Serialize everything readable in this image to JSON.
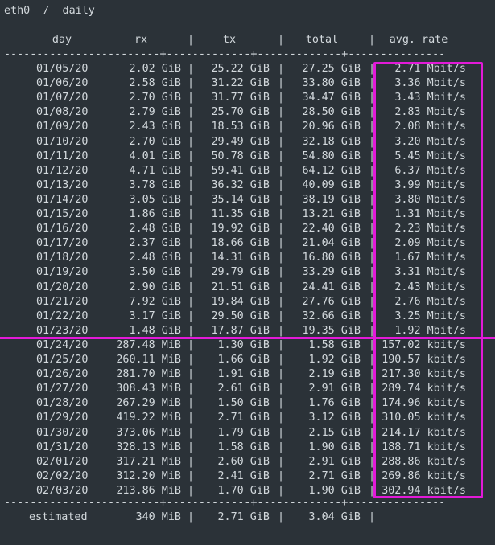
{
  "title": "eth0  /  daily",
  "header": {
    "day": "day",
    "rx": "rx",
    "tx": "tx",
    "total": "total",
    "rate": "avg. rate"
  },
  "separator_top": "------------------------+-------------+-------------+---------------",
  "separator_bottom": "------------------------+-------------+-------------+---------------",
  "rows": [
    {
      "day": "01/05/20",
      "rx": "2.02 GiB",
      "tx": "25.22 GiB",
      "total": "27.25 GiB",
      "rate": "2.71 Mbit/s"
    },
    {
      "day": "01/06/20",
      "rx": "2.58 GiB",
      "tx": "31.22 GiB",
      "total": "33.80 GiB",
      "rate": "3.36 Mbit/s"
    },
    {
      "day": "01/07/20",
      "rx": "2.70 GiB",
      "tx": "31.77 GiB",
      "total": "34.47 GiB",
      "rate": "3.43 Mbit/s"
    },
    {
      "day": "01/08/20",
      "rx": "2.79 GiB",
      "tx": "25.70 GiB",
      "total": "28.50 GiB",
      "rate": "2.83 Mbit/s"
    },
    {
      "day": "01/09/20",
      "rx": "2.43 GiB",
      "tx": "18.53 GiB",
      "total": "20.96 GiB",
      "rate": "2.08 Mbit/s"
    },
    {
      "day": "01/10/20",
      "rx": "2.70 GiB",
      "tx": "29.49 GiB",
      "total": "32.18 GiB",
      "rate": "3.20 Mbit/s"
    },
    {
      "day": "01/11/20",
      "rx": "4.01 GiB",
      "tx": "50.78 GiB",
      "total": "54.80 GiB",
      "rate": "5.45 Mbit/s"
    },
    {
      "day": "01/12/20",
      "rx": "4.71 GiB",
      "tx": "59.41 GiB",
      "total": "64.12 GiB",
      "rate": "6.37 Mbit/s"
    },
    {
      "day": "01/13/20",
      "rx": "3.78 GiB",
      "tx": "36.32 GiB",
      "total": "40.09 GiB",
      "rate": "3.99 Mbit/s"
    },
    {
      "day": "01/14/20",
      "rx": "3.05 GiB",
      "tx": "35.14 GiB",
      "total": "38.19 GiB",
      "rate": "3.80 Mbit/s"
    },
    {
      "day": "01/15/20",
      "rx": "1.86 GiB",
      "tx": "11.35 GiB",
      "total": "13.21 GiB",
      "rate": "1.31 Mbit/s"
    },
    {
      "day": "01/16/20",
      "rx": "2.48 GiB",
      "tx": "19.92 GiB",
      "total": "22.40 GiB",
      "rate": "2.23 Mbit/s"
    },
    {
      "day": "01/17/20",
      "rx": "2.37 GiB",
      "tx": "18.66 GiB",
      "total": "21.04 GiB",
      "rate": "2.09 Mbit/s"
    },
    {
      "day": "01/18/20",
      "rx": "2.48 GiB",
      "tx": "14.31 GiB",
      "total": "16.80 GiB",
      "rate": "1.67 Mbit/s"
    },
    {
      "day": "01/19/20",
      "rx": "3.50 GiB",
      "tx": "29.79 GiB",
      "total": "33.29 GiB",
      "rate": "3.31 Mbit/s"
    },
    {
      "day": "01/20/20",
      "rx": "2.90 GiB",
      "tx": "21.51 GiB",
      "total": "24.41 GiB",
      "rate": "2.43 Mbit/s"
    },
    {
      "day": "01/21/20",
      "rx": "7.92 GiB",
      "tx": "19.84 GiB",
      "total": "27.76 GiB",
      "rate": "2.76 Mbit/s"
    },
    {
      "day": "01/22/20",
      "rx": "3.17 GiB",
      "tx": "29.50 GiB",
      "total": "32.66 GiB",
      "rate": "3.25 Mbit/s"
    },
    {
      "day": "01/23/20",
      "rx": "1.48 GiB",
      "tx": "17.87 GiB",
      "total": "19.35 GiB",
      "rate": "1.92 Mbit/s"
    },
    {
      "day": "01/24/20",
      "rx": "287.48 MiB",
      "tx": "1.30 GiB",
      "total": "1.58 GiB",
      "rate": "157.02 kbit/s"
    },
    {
      "day": "01/25/20",
      "rx": "260.11 MiB",
      "tx": "1.66 GiB",
      "total": "1.92 GiB",
      "rate": "190.57 kbit/s"
    },
    {
      "day": "01/26/20",
      "rx": "281.70 MiB",
      "tx": "1.91 GiB",
      "total": "2.19 GiB",
      "rate": "217.30 kbit/s"
    },
    {
      "day": "01/27/20",
      "rx": "308.43 MiB",
      "tx": "2.61 GiB",
      "total": "2.91 GiB",
      "rate": "289.74 kbit/s"
    },
    {
      "day": "01/28/20",
      "rx": "267.29 MiB",
      "tx": "1.50 GiB",
      "total": "1.76 GiB",
      "rate": "174.96 kbit/s"
    },
    {
      "day": "01/29/20",
      "rx": "419.22 MiB",
      "tx": "2.71 GiB",
      "total": "3.12 GiB",
      "rate": "310.05 kbit/s"
    },
    {
      "day": "01/30/20",
      "rx": "373.06 MiB",
      "tx": "1.79 GiB",
      "total": "2.15 GiB",
      "rate": "214.17 kbit/s"
    },
    {
      "day": "01/31/20",
      "rx": "328.13 MiB",
      "tx": "1.58 GiB",
      "total": "1.90 GiB",
      "rate": "188.71 kbit/s"
    },
    {
      "day": "02/01/20",
      "rx": "317.21 MiB",
      "tx": "2.60 GiB",
      "total": "2.91 GiB",
      "rate": "288.86 kbit/s"
    },
    {
      "day": "02/02/20",
      "rx": "312.20 MiB",
      "tx": "2.41 GiB",
      "total": "2.71 GiB",
      "rate": "269.86 kbit/s"
    },
    {
      "day": "02/03/20",
      "rx": "213.86 MiB",
      "tx": "1.70 GiB",
      "total": "1.90 GiB",
      "rate": "302.94 kbit/s"
    }
  ],
  "estimated": {
    "day": "estimated",
    "rx": "340 MiB",
    "tx": "2.71 GiB",
    "total": "3.04 GiB",
    "rate": ""
  },
  "colors": {
    "background": "#2b3238",
    "text": "#d2d8dc",
    "highlight": "#e21ad8"
  }
}
